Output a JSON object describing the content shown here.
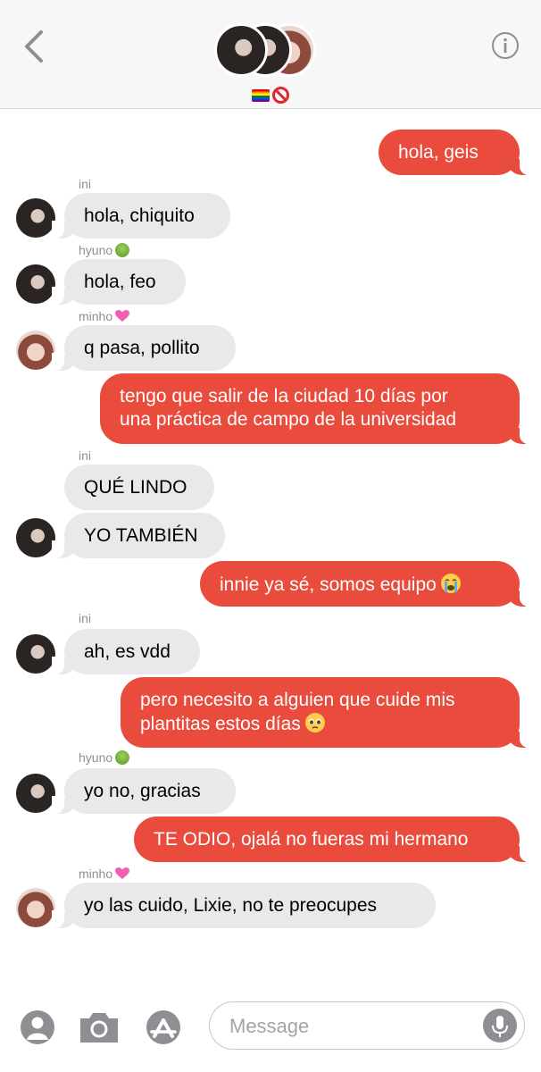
{
  "header": {
    "group_emojis": [
      "rainbow-flag",
      "prohibited"
    ]
  },
  "messages": [
    {
      "dir": "out",
      "text": "hola, geis"
    },
    {
      "dir": "in",
      "sender": "ini",
      "text": "hola, chiquito"
    },
    {
      "dir": "in",
      "sender": "hyuno",
      "sender_emoji": "nauseated-face",
      "text": "hola, feo"
    },
    {
      "dir": "in",
      "sender": "minho",
      "sender_emoji": "pink-heart",
      "text": "q pasa, pollito"
    },
    {
      "dir": "out",
      "lines": [
        "tengo que salir de la ciudad 10 días por",
        "una práctica de campo de la universidad"
      ]
    },
    {
      "dir": "in",
      "sender": "ini",
      "text": "QUÉ LINDO"
    },
    {
      "dir": "in",
      "text": "YO TAMBIÉN"
    },
    {
      "dir": "out",
      "text": "innie ya sé, somos equipo",
      "emoji": "loudly-crying-face"
    },
    {
      "dir": "in",
      "sender": "ini",
      "text": "ah, es vdd"
    },
    {
      "dir": "out",
      "lines": [
        "pero necesito a alguien que cuide mis",
        "plantitas estos días"
      ],
      "emoji": "pleading-face"
    },
    {
      "dir": "in",
      "sender": "hyuno",
      "sender_emoji": "nauseated-face",
      "text": "yo no, gracias"
    },
    {
      "dir": "out",
      "text": "TE ODIO, ojalá no fueras mi hermano"
    },
    {
      "dir": "in",
      "sender": "minho",
      "sender_emoji": "pink-heart",
      "text": "yo las cuido, Lixie, no te preocupes"
    }
  ],
  "input": {
    "placeholder": "Message"
  },
  "colors": {
    "outgoing_bubble": "#e94b3c",
    "incoming_bubble": "#e9e9eb",
    "sender_label": "#8e8e93"
  }
}
